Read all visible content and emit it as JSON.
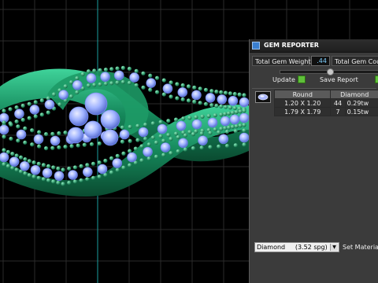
{
  "panel": {
    "title": "GEM REPORTER",
    "total_gem_weight_label": "Total Gem Weight",
    "total_gem_weight_value": ".44",
    "total_gem_count_label": "Total Gem Count",
    "update_label": "Update",
    "save_report_label": "Save Report",
    "table": {
      "headers": [
        "Round",
        "Diamond"
      ],
      "rows": [
        {
          "size": "1.20 X 1.20",
          "count": "44",
          "weight": "0.29tw"
        },
        {
          "size": "1.79 X 1.79",
          "count": "7",
          "weight": "0.15tw"
        }
      ]
    },
    "material_select_value": "Diamond     (3.52 spg)",
    "set_material_label": "Set Material"
  },
  "colors": {
    "viewport_bg": "#000000",
    "grid": "#2a2a2a",
    "metal": "#1f8f5c",
    "gem": "#8fa8ff",
    "panel_bg": "#3b3b3b",
    "accent_green": "#5fbf3a"
  },
  "icons": {
    "app": "gem-reporter-icon",
    "update": "green-square-icon",
    "save": "green-square-icon",
    "gem_thumb": "round-gem-icon",
    "dropdown": "chevron-down-icon"
  }
}
